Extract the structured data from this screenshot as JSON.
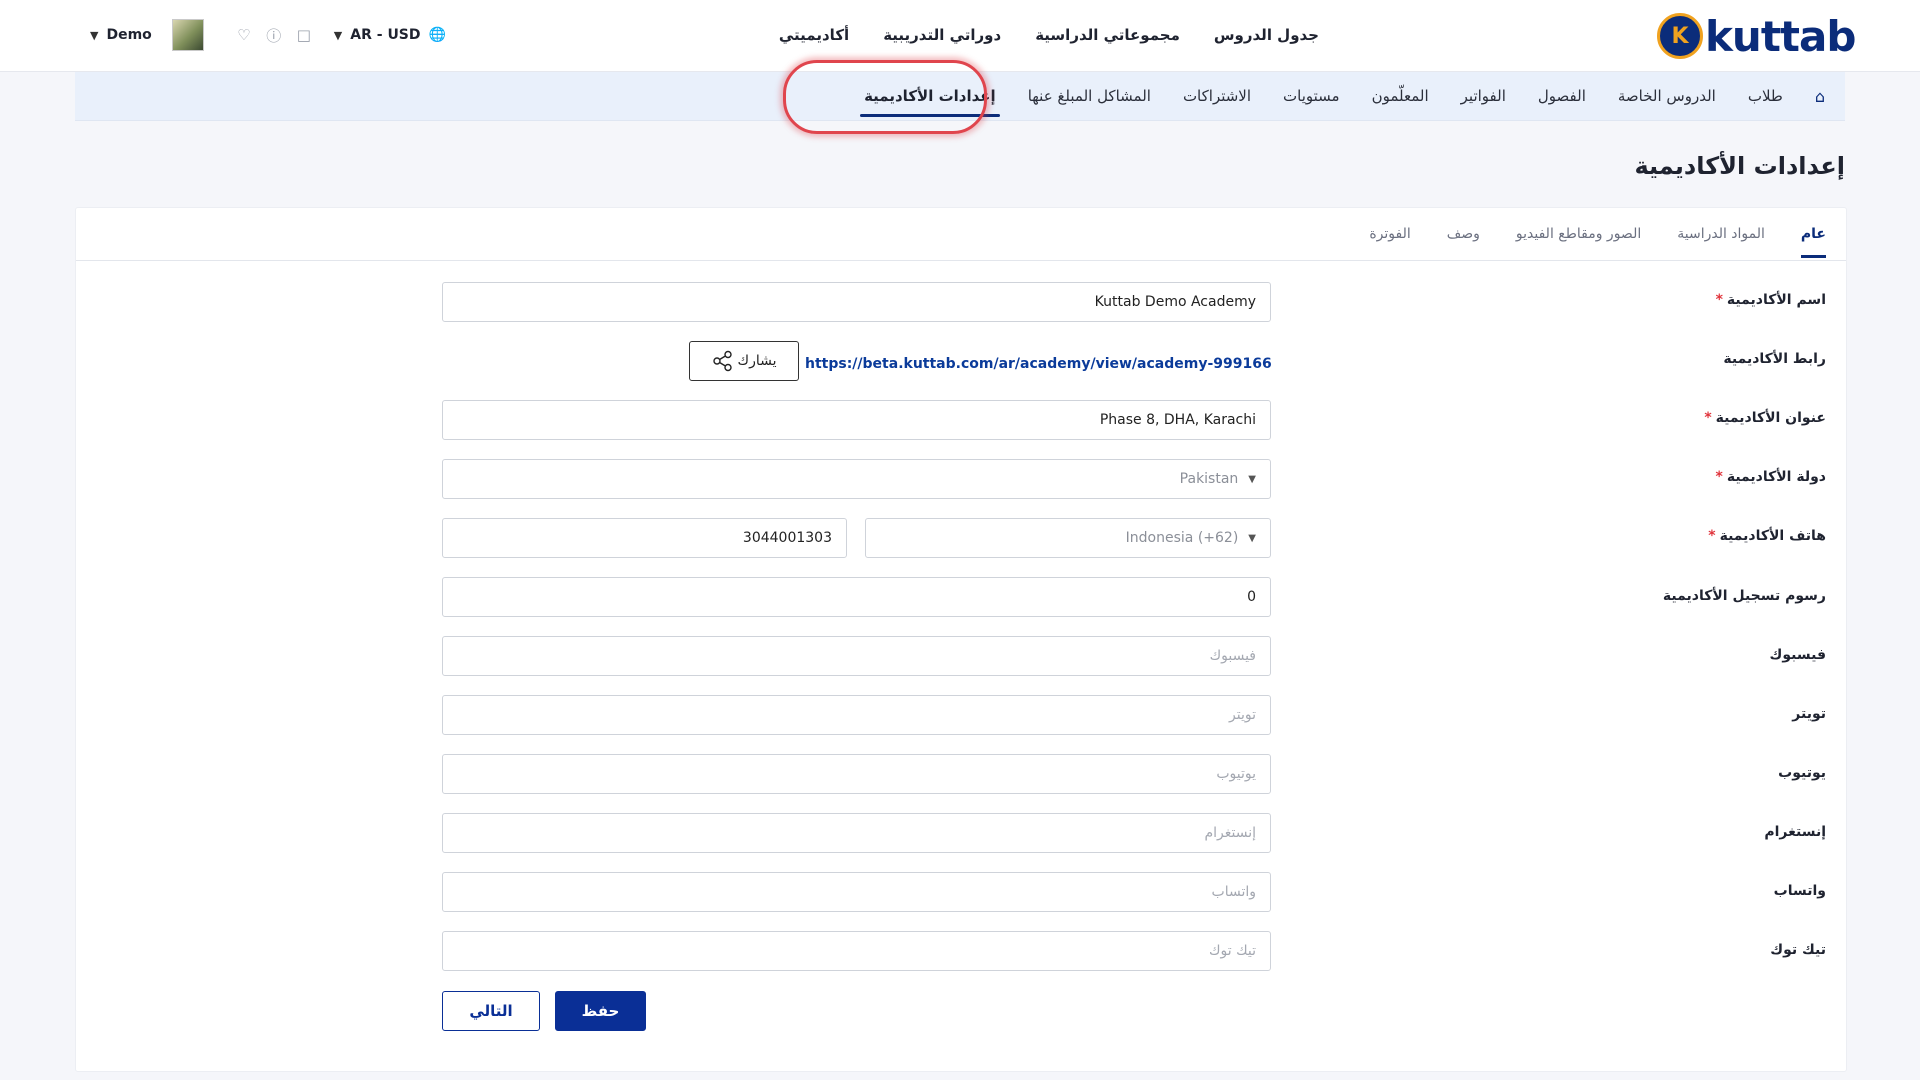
{
  "header": {
    "logo_letter": "K",
    "logo_text": "kuttab",
    "nav": [
      "جدول الدروس",
      "مجموعاتي الدراسية",
      "دوراتي التدريبية",
      "أكاديميتي"
    ],
    "language_currency": "AR - USD",
    "user_name": "Demo",
    "icons": [
      "globe-icon",
      "chat-icon",
      "help-icon",
      "heart-icon",
      "chevron-down-icon"
    ]
  },
  "subnav": {
    "items": [
      "طلاب",
      "الدروس الخاصة",
      "الفصول",
      "الفواتير",
      "المعلّمون",
      "مستويات",
      "الاشتراكات",
      "المشاكل المبلغ عنها",
      "إعدادات الأكاديمية"
    ],
    "active": "إعدادات الأكاديمية"
  },
  "page": {
    "title": "إعدادات الأكاديمية"
  },
  "tabs": {
    "items": [
      "عام",
      "المواد الدراسية",
      "الصور ومقاطع الفيديو",
      "وصف",
      "الفوترة"
    ],
    "active": "عام"
  },
  "form": {
    "academy_name": {
      "label": "اسم الأكاديمية",
      "required": "*",
      "value": "Kuttab Demo Academy"
    },
    "academy_link": {
      "label": "رابط الأكاديمية",
      "value": "https://beta.kuttab.com/ar/academy/view/academy-999166",
      "share_label": "يشارك"
    },
    "academy_address": {
      "label": "عنوان الأكاديمية",
      "required": "*",
      "value": "Phase 8, DHA, Karachi"
    },
    "academy_country": {
      "label": "دولة الأكاديمية",
      "required": "*",
      "value": "Pakistan"
    },
    "academy_phone": {
      "label": "هاتف الأكاديمية",
      "required": "*",
      "country_code": "Indonesia (+62)",
      "value": "3044001303"
    },
    "registration_fee": {
      "label": "رسوم تسجيل الأكاديمية",
      "value": "0"
    },
    "facebook": {
      "label": "فيسبوك",
      "placeholder": "فيسبوك"
    },
    "twitter": {
      "label": "تويتر",
      "placeholder": "تويتر"
    },
    "youtube": {
      "label": "يوتيوب",
      "placeholder": "يوتيوب"
    },
    "instagram": {
      "label": "إنستغرام",
      "placeholder": "إنستغرام"
    },
    "whatsapp": {
      "label": "واتساب",
      "placeholder": "واتساب"
    },
    "tiktok": {
      "label": "تيك توك",
      "placeholder": "تيك توك"
    }
  },
  "actions": {
    "save": "حفظ",
    "next": "التالي"
  },
  "colors": {
    "brand": "#0b2c7a",
    "primary_button": "#0a2f96",
    "link": "#0b3b9a",
    "required": "#e0333b",
    "highlight_ring": "#e0454d",
    "subnav_bg": "#e9f0fb"
  }
}
